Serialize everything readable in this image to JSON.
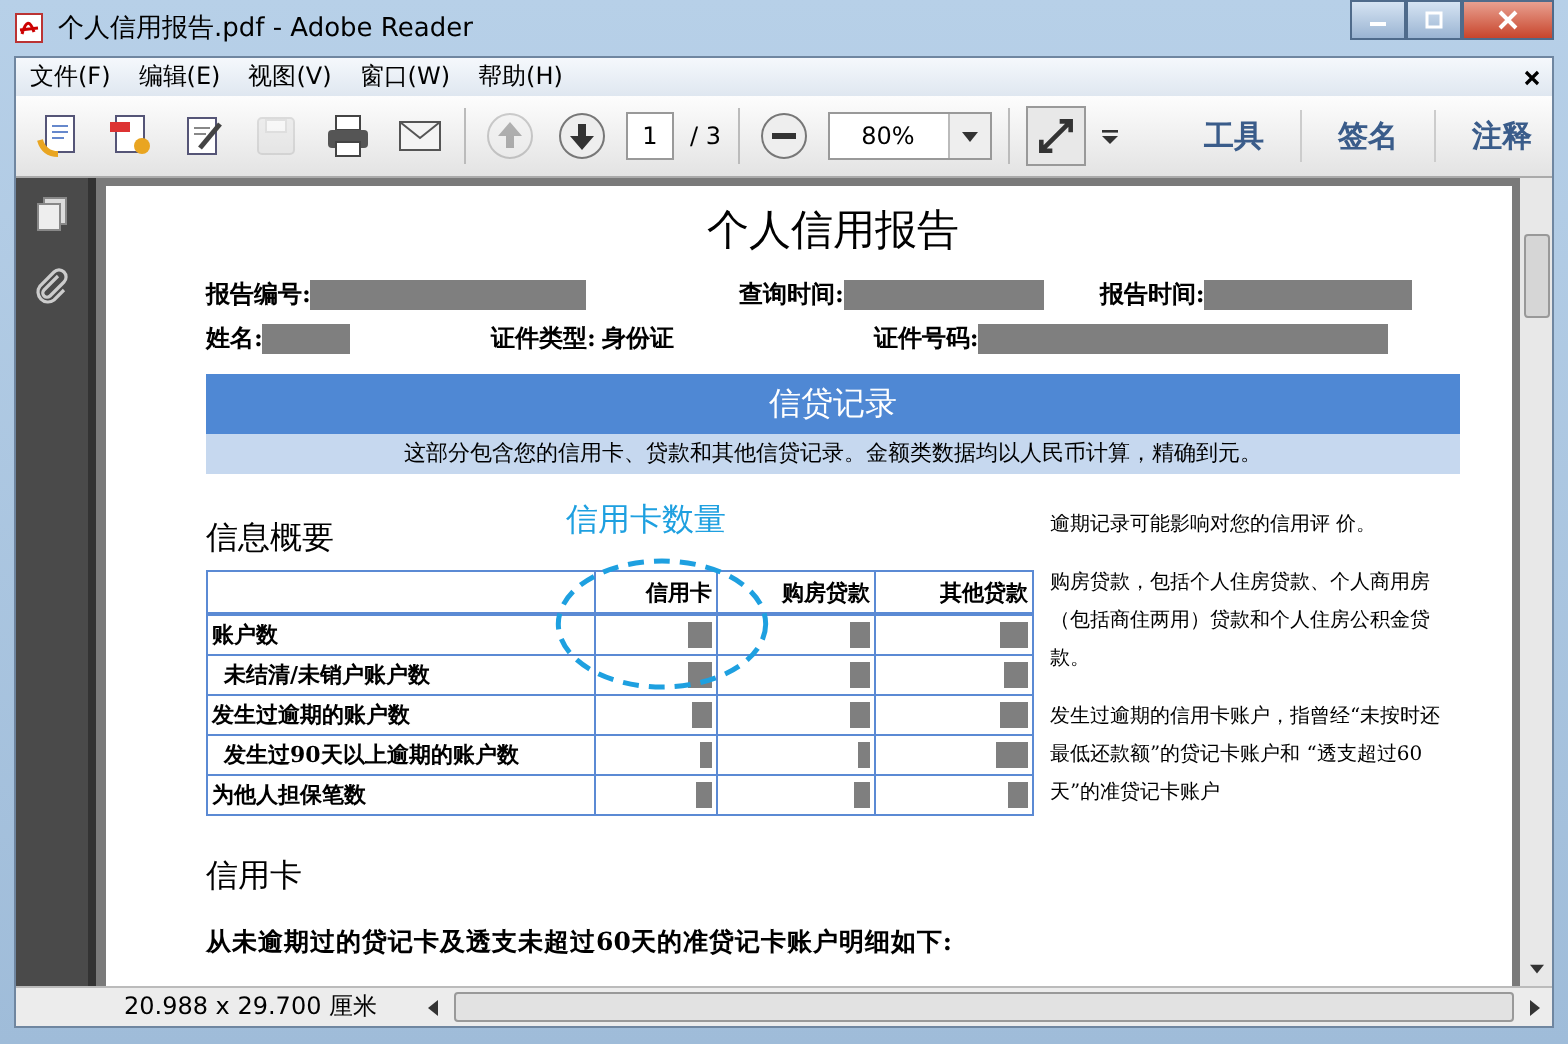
{
  "window": {
    "title": "个人信用报告.pdf - Adobe Reader"
  },
  "menu": [
    "文件(F)",
    "编辑(E)",
    "视图(V)",
    "窗口(W)",
    "帮助(H)"
  ],
  "toolbar": {
    "tools": [
      {
        "kind": "open",
        "disabled": false
      },
      {
        "kind": "create",
        "disabled": false
      },
      {
        "kind": "edit",
        "disabled": false
      },
      {
        "kind": "save",
        "disabled": true
      },
      {
        "kind": "print",
        "disabled": false
      },
      {
        "kind": "mail",
        "disabled": false
      }
    ],
    "nav": [
      {
        "kind": "up",
        "disabled": true
      },
      {
        "kind": "down",
        "disabled": false
      }
    ],
    "page": "1",
    "pages": "/ 3",
    "zoom": "80%",
    "panels": [
      "工具",
      "签名",
      "注释"
    ]
  },
  "document": {
    "title": "个人信用报告",
    "info_rows": [
      [
        {
          "label": "报告编号:"
        },
        {
          "label": "查询时间:"
        },
        {
          "label": "报告时间:"
        }
      ],
      [
        {
          "label": "姓名:"
        },
        {
          "label": "证件类型:",
          "value": "身份证"
        },
        {
          "label": "证件号码:"
        }
      ]
    ],
    "banner": "信贷记录",
    "banner_note": "这部分包含您的信用卡、贷款和其他信贷记录。金额类数据均以人民币计算，精确到元。",
    "summary_title": "信息概要",
    "annotation": "信用卡数量",
    "columns": [
      "信用卡",
      "购房贷款",
      "其他贷款"
    ],
    "rows": [
      {
        "label": "账户数",
        "children": [
          {
            "label": "未结清/未销户账户数"
          }
        ]
      },
      {
        "label": "发生过逾期的账户数",
        "children": [
          {
            "label": "发生过90天以上逾期的账户数"
          }
        ]
      },
      {
        "label": "为他人担保笔数"
      }
    ],
    "notes": [
      "逾期记录可能影响对您的信用评 价。",
      "购房贷款，包括个人住房贷款、个人商用房（包括商住两用）贷款和个人住房公积金贷款。",
      "发生过逾期的信用卡账户，指曾经“未按时还最低还款额”的贷记卡账户和 “透支超过60天”的准贷记卡账户"
    ],
    "section": "信用卡",
    "section_text": "从未逾期过的贷记卡及透支未超过60天的准贷记卡账户明细如下:"
  },
  "status_bar": {
    "size": "20.988 x 29.700 厘米"
  }
}
